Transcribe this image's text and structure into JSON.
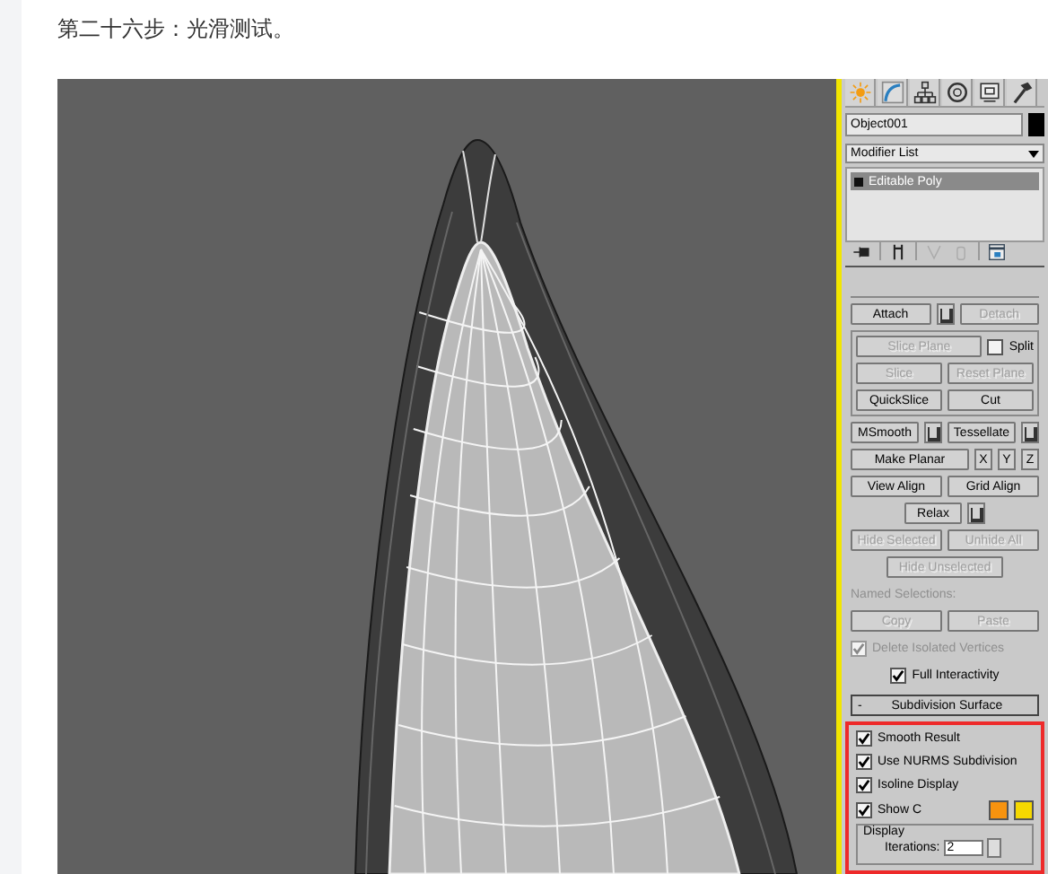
{
  "heading": "第二十六步：光滑测试。",
  "command_panel": {
    "object_name": "Object001",
    "modifier_list": "Modifier List",
    "stack": [
      {
        "label": "Editable Poly",
        "selected": true
      }
    ],
    "sections": [
      {
        "kind": "plain",
        "rows": [
          {
            "kind": "split",
            "items": [
              {
                "kind": "button",
                "label": "Attach",
                "disabled": false
              },
              {
                "kind": "square"
              },
              {
                "kind": "button",
                "label": "Detach",
                "disabled": true
              }
            ]
          }
        ]
      },
      {
        "kind": "framed",
        "rows": [
          {
            "kind": "split",
            "items": [
              {
                "kind": "button",
                "label": "Slice Plane",
                "disabled": true
              },
              {
                "kind": "checkbox",
                "label": "Split",
                "checked": false,
                "disabled": false
              }
            ]
          },
          {
            "kind": "split",
            "items": [
              {
                "kind": "button",
                "label": "Slice",
                "disabled": true
              },
              {
                "kind": "button",
                "label": "Reset Plane",
                "disabled": true
              }
            ]
          },
          {
            "kind": "split",
            "items": [
              {
                "kind": "button",
                "label": "QuickSlice",
                "disabled": false
              },
              {
                "kind": "button",
                "label": "Cut",
                "disabled": false
              }
            ]
          }
        ]
      },
      {
        "kind": "plain",
        "rows": [
          {
            "kind": "split",
            "items": [
              {
                "kind": "button",
                "label": "MSmooth",
                "disabled": false
              },
              {
                "kind": "square"
              },
              {
                "kind": "button",
                "label": "Tessellate",
                "disabled": false
              },
              {
                "kind": "square"
              }
            ]
          },
          {
            "kind": "split",
            "items": [
              {
                "kind": "button",
                "label": "Make Planar",
                "disabled": false
              },
              {
                "kind": "axis",
                "label": "X",
                "disabled": false
              },
              {
                "kind": "axis",
                "label": "Y",
                "disabled": false
              },
              {
                "kind": "axis",
                "label": "Z",
                "disabled": false
              }
            ]
          },
          {
            "kind": "split",
            "items": [
              {
                "kind": "button",
                "label": "View Align",
                "disabled": false
              },
              {
                "kind": "button",
                "label": "Grid Align",
                "disabled": false
              }
            ]
          },
          {
            "kind": "center",
            "items": [
              {
                "kind": "button",
                "label": "Relax",
                "disabled": false
              },
              {
                "kind": "square"
              }
            ]
          },
          {
            "kind": "split",
            "items": [
              {
                "kind": "button",
                "label": "Hide Selected",
                "disabled": true
              },
              {
                "kind": "button",
                "label": "Unhide All",
                "disabled": true
              }
            ]
          },
          {
            "kind": "center",
            "items": [
              {
                "kind": "button",
                "label": "Hide Unselected",
                "disabled": true
              }
            ]
          },
          {
            "kind": "split",
            "items": [
              {
                "kind": "label",
                "label": "Named Selections:",
                "disabled": true
              }
            ]
          },
          {
            "kind": "split",
            "items": [
              {
                "kind": "button",
                "label": "Copy",
                "disabled": true
              },
              {
                "kind": "button",
                "label": "Paste",
                "disabled": true
              }
            ]
          },
          {
            "kind": "split",
            "items": [
              {
                "kind": "checkbox",
                "label": "Delete Isolated Vertices",
                "checked": true,
                "disabled": true
              }
            ]
          },
          {
            "kind": "center",
            "items": [
              {
                "kind": "checkbox",
                "label": "Full Interactivity",
                "checked": true,
                "disabled": false
              }
            ]
          }
        ]
      }
    ],
    "rollout": {
      "sign": "-",
      "label": "Subdivision Surface"
    },
    "subdivision": {
      "checkboxes": [
        {
          "label": "Smooth Result",
          "checked": true
        },
        {
          "label": "Use NURMS Subdivision",
          "checked": true
        },
        {
          "label": "Isoline Display",
          "checked": true
        },
        {
          "label": "Show C",
          "checked": true
        }
      ],
      "swatches": [
        {
          "color": "#f7930f"
        },
        {
          "color": "#f5d800"
        }
      ],
      "display_group": {
        "label": "Display",
        "iterations_label": "Iterations:",
        "iterations": "2"
      }
    }
  }
}
